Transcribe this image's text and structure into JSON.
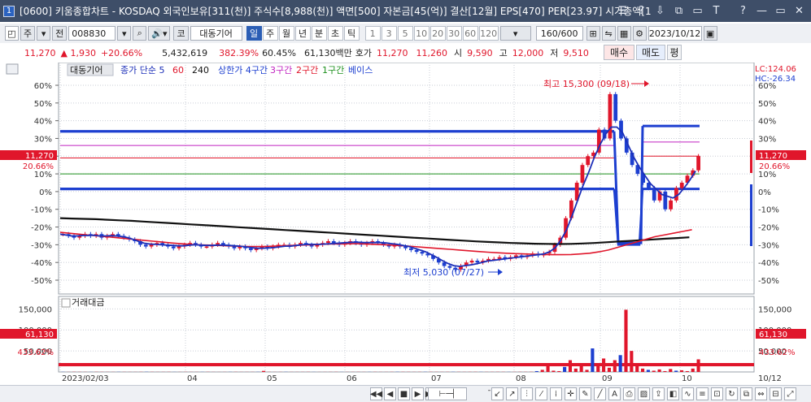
{
  "window": {
    "app_number": "1",
    "title": "[0600] 키움종합차트 - KOSDAQ 외국인보유[311(천)] 주식수[8,988(천)] 액면[500] 자본금[45(억)] 결산[12월] EPS[470] PER[23.97] 시가총액[1"
  },
  "window_buttons": [
    "☰",
    "?",
    "⇩",
    "⧉",
    "▭",
    "T",
    "?",
    "—",
    "▭",
    "✕"
  ],
  "toolbar": {
    "market_code": "주",
    "market_type": "전",
    "stock_code": "008830",
    "stock_name": "대동기어",
    "stock_prefix": "코",
    "periods": [
      "일",
      "주",
      "월",
      "년",
      "분",
      "초",
      "틱"
    ],
    "active_period": "일",
    "intervals": [
      "1",
      "3",
      "5",
      "10",
      "20",
      "30",
      "60",
      "120"
    ],
    "count": "160",
    "count_total": "/600",
    "date": "2023/10/12"
  },
  "quote": {
    "price": "11,270",
    "change": "▲    1,930",
    "change_pct": "+20.66%",
    "volume": "5,432,619",
    "volume_ratio": "382.39%",
    "turnover": "60.45%",
    "amount": "61,130백만",
    "label_ho": "호가",
    "ask": "11,270",
    "bid": "11,260",
    "label_open": "시",
    "open": "9,590",
    "label_high": "고",
    "high": "12,000",
    "label_low": "저",
    "low": "9,510",
    "buy_label": "매수",
    "sell_label": "매도",
    "avg_label": "평"
  },
  "chart_data": [
    {
      "type": "line",
      "title": "대동기어",
      "legend": [
        "종가 단순 5",
        "60",
        "240",
        "상한가 4구간",
        "3구간",
        "2구간",
        "1구간",
        "베이스"
      ],
      "legend_colors": [
        "#1c2fb8",
        "#e0162b",
        "#111111",
        "#1d3fd0",
        "#c020c0",
        "#e0162b",
        "#1a8f1a",
        "#1d3fd0"
      ],
      "x_ticks": [
        "2023/02/03",
        "04",
        "05",
        "06",
        "07",
        "08",
        "09",
        "10",
        "10/12"
      ],
      "y_ticks_pct": [
        "60%",
        "50%",
        "40%",
        "30%",
        "20%",
        "10%",
        "0%",
        "-10%",
        "-20%",
        "-30%",
        "-40%",
        "-50%"
      ],
      "ylim_pct": [
        -50,
        60
      ],
      "current_price_label": "11,270",
      "current_pct_label": "20.66%",
      "lc_label": "LC:124.06",
      "hc_label": "HC:-26.34",
      "high_annotation": "최고 15,300 (09/18)",
      "low_annotation": "최저 5,030 (07/27)",
      "close_pct": [
        -24,
        -25,
        -26,
        -25,
        -24,
        -25,
        -24,
        -26,
        -25,
        -24,
        -25,
        -26,
        -27,
        -28,
        -30,
        -31,
        -30,
        -29,
        -30,
        -31,
        -32,
        -31,
        -30,
        -29,
        -30,
        -31,
        -31,
        -30,
        -29,
        -30,
        -31,
        -32,
        -31,
        -32,
        -33,
        -32,
        -31,
        -32,
        -31,
        -30,
        -30,
        -31,
        -30,
        -29,
        -30,
        -31,
        -30,
        -29,
        -28,
        -29,
        -30,
        -29,
        -28,
        -29,
        -30,
        -29,
        -28,
        -29,
        -30,
        -31,
        -30,
        -31,
        -32,
        -33,
        -34,
        -35,
        -36,
        -38,
        -40,
        -42,
        -43,
        -44,
        -42,
        -40,
        -39,
        -40,
        -39,
        -38,
        -38,
        -37,
        -38,
        -37,
        -36,
        -37,
        -36,
        -35,
        -36,
        -35,
        -34,
        -30,
        -26,
        -15,
        -5,
        5,
        15,
        20,
        22,
        35,
        30,
        55,
        40,
        30,
        22,
        15,
        10,
        5,
        2,
        -5,
        0,
        -10,
        -5,
        2,
        5,
        9,
        12,
        20
      ],
      "ma5_pct": [
        -24,
        -24.5,
        -25,
        -25,
        -24.8,
        -24.8,
        -24.6,
        -25,
        -25,
        -24.9,
        -25,
        -25.4,
        -26,
        -27,
        -28.2,
        -29.2,
        -29.6,
        -29.8,
        -30,
        -30.2,
        -30.4,
        -30.6,
        -30.6,
        -30.2,
        -30,
        -30.2,
        -30.4,
        -30.4,
        -30.2,
        -30.2,
        -30.4,
        -30.6,
        -30.8,
        -31.2,
        -31.6,
        -32,
        -32,
        -31.8,
        -31.6,
        -31.2,
        -30.8,
        -30.8,
        -30.4,
        -30,
        -29.8,
        -29.8,
        -29.8,
        -29.6,
        -29.4,
        -29.2,
        -29,
        -28.8,
        -28.6,
        -28.6,
        -28.8,
        -28.8,
        -28.8,
        -28.8,
        -29,
        -29.4,
        -29.8,
        -30.4,
        -31,
        -32,
        -33,
        -34,
        -35.6,
        -37.2,
        -39,
        -40.6,
        -41.8,
        -42.2,
        -41.8,
        -41.4,
        -40.8,
        -40,
        -39.2,
        -38.8,
        -38.4,
        -38,
        -37.6,
        -37.2,
        -36.8,
        -36.4,
        -36,
        -35.6,
        -35.2,
        -34,
        -31.8,
        -27.6,
        -22,
        -14,
        -5.2,
        3.4,
        11,
        19.4,
        26.4,
        32.4,
        36.4,
        36.4,
        33.4,
        26.4,
        19.4,
        13.8,
        9,
        4.4,
        1.4,
        -1.6,
        -2.6,
        -3.6,
        -1.6,
        2.2,
        6.6,
        11.6
      ],
      "ma60_pct": [
        -23,
        -23.5,
        -24,
        -24.5,
        -25,
        -25.5,
        -26,
        -26.5,
        -27,
        -27.5,
        -28,
        -28.5,
        -29,
        -29.4,
        -29.8,
        -30,
        -30.2,
        -30.4,
        -30.6,
        -30.8,
        -31,
        -31,
        -31,
        -30.8,
        -30.6,
        -30.4,
        -30.2,
        -30,
        -29.8,
        -29.6,
        -29.5,
        -29.4,
        -29.4,
        -29.6,
        -29.8,
        -30,
        -30.3,
        -30.6,
        -31,
        -31.4,
        -31.8,
        -32.2,
        -32.6,
        -33,
        -33.4,
        -33.8,
        -34.2,
        -34.5,
        -34.8,
        -35,
        -35.2,
        -35.4,
        -35.5,
        -35.6,
        -35.6,
        -35.5,
        -35.2,
        -34.8,
        -34,
        -33,
        -31.5,
        -30,
        -28.5,
        -27,
        -25.5,
        -24.5,
        -23.5,
        -22.5,
        -21.5
      ],
      "ma240_pct": [
        -15,
        -15.2,
        -15.4,
        -15.6,
        -15.9,
        -16.2,
        -16.5,
        -16.9,
        -17.3,
        -17.7,
        -18.1,
        -18.5,
        -18.9,
        -19.3,
        -19.7,
        -20.1,
        -20.5,
        -20.9,
        -21.3,
        -21.7,
        -22.1,
        -22.5,
        -22.9,
        -23.3,
        -23.7,
        -24.1,
        -24.5,
        -24.9,
        -25.3,
        -25.7,
        -26.1,
        -26.5,
        -26.9,
        -27.3,
        -27.7,
        -28.1,
        -28.4,
        -28.7,
        -29,
        -29.2,
        -29.4,
        -29.5,
        -29.6,
        -29.5,
        -29.3,
        -29,
        -28.6,
        -28.2,
        -27.8,
        -27.4,
        -27,
        -26.6,
        -26.2,
        -25.8
      ]
    },
    {
      "type": "bar",
      "title": "거래대금",
      "y_ticks": [
        "150,000",
        "100,000",
        "50,000"
      ],
      "ylim": [
        0,
        170000
      ],
      "current_label": "61,130",
      "current_pct": "433.62%",
      "values": [
        300,
        200,
        400,
        300,
        250,
        200,
        350,
        300,
        250,
        200,
        300,
        250,
        200,
        200,
        300,
        400,
        300,
        200,
        250,
        300,
        200,
        200,
        300,
        250,
        200,
        250,
        300,
        200,
        150,
        200,
        250,
        300,
        200,
        200,
        250,
        300,
        2500,
        300,
        200,
        250,
        300,
        200,
        200,
        250,
        300,
        200,
        150,
        200,
        250,
        300,
        200,
        200,
        250,
        300,
        200,
        250,
        300,
        200,
        200,
        300,
        400,
        350,
        300,
        250,
        300,
        350,
        400,
        300,
        250,
        300,
        350,
        300,
        250,
        300,
        350,
        300,
        250,
        300,
        350,
        300,
        250,
        300,
        350,
        300,
        400,
        2000,
        5000,
        15000,
        3000,
        2000,
        12000,
        28000,
        8000,
        20000,
        5000,
        56000,
        15000,
        32000,
        10000,
        28000,
        40000,
        148000,
        50000,
        18000,
        8000,
        5000,
        3000,
        6000,
        2000,
        7000,
        3000,
        4000,
        2000,
        8000,
        30000
      ]
    }
  ],
  "bottom_controls": [
    "◀◀",
    "◀",
    "■",
    "▶",
    "▶▶"
  ]
}
